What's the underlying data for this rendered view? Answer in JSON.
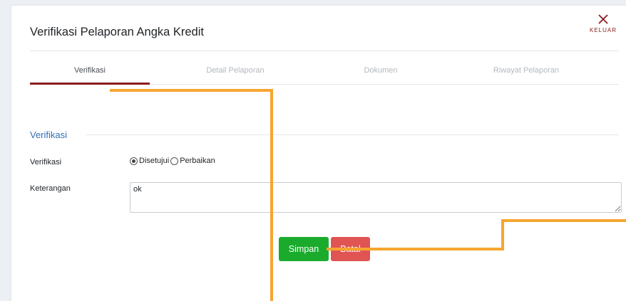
{
  "modal": {
    "title": "Verifikasi Pelaporan Angka Kredit",
    "close": {
      "label": "KELUAR",
      "icon": "close-icon"
    }
  },
  "tabs": [
    {
      "label": "Verifikasi",
      "active": true
    },
    {
      "label": "Detail Pelaporan",
      "active": false
    },
    {
      "label": "Dokumen",
      "active": false
    },
    {
      "label": "Riwayat Pelaporan",
      "active": false
    }
  ],
  "form": {
    "section_title": "Verifikasi",
    "verifikasi": {
      "label": "Verifikasi",
      "options": [
        {
          "label": "Disetujui",
          "checked": true
        },
        {
          "label": "Perbaikan",
          "checked": false
        }
      ]
    },
    "keterangan": {
      "label": "Keterangan",
      "value": "ok"
    }
  },
  "buttons": {
    "save": "Simpan",
    "cancel": "Batal"
  },
  "colors": {
    "accent": "#8b1c1c",
    "section": "#2f6fb3",
    "save": "#1aab2d",
    "cancel": "#e05454",
    "annotation": "#f7a530"
  }
}
